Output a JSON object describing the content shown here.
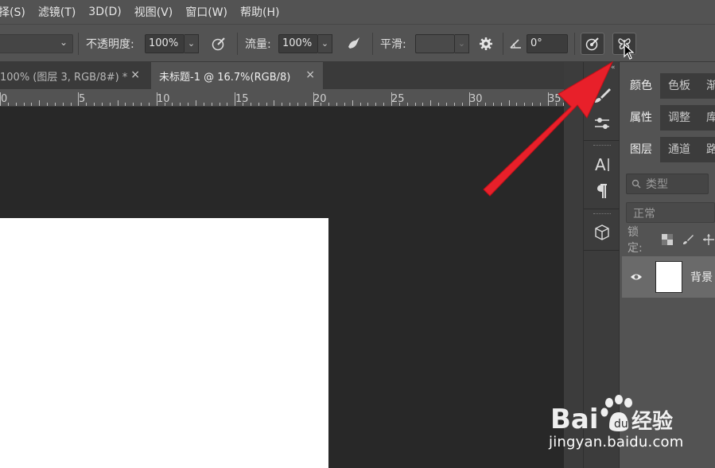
{
  "menu": [
    "择(S)",
    "滤镜(T)",
    "3D(D)",
    "视图(V)",
    "窗口(W)",
    "帮助(H)"
  ],
  "options": {
    "opacity_label": "不透明度:",
    "opacity_value": "100%",
    "flow_label": "流量:",
    "flow_value": "100%",
    "smooth_label": "平滑:",
    "smooth_value": "",
    "angle_value": "0°"
  },
  "tabs": [
    {
      "label": "100% (图层 3, RGB/8#) *",
      "close": "×"
    },
    {
      "label": "未标题-1 @ 16.7%(RGB/8)",
      "close": "×"
    }
  ],
  "ruler": {
    "ticks": [
      "0",
      "5",
      "10",
      "15",
      "20",
      "25",
      "30",
      "35"
    ]
  },
  "dock": {
    "collapse": "«"
  },
  "panels": {
    "group1": [
      "颜色",
      "色板",
      "渐"
    ],
    "group2": [
      "属性",
      "调整",
      "库"
    ],
    "group3": [
      "图层",
      "通道",
      "路"
    ],
    "filter_placeholder": "类型",
    "blend_mode": "正常",
    "lock_label": "锁定:",
    "layer_name": "背景"
  },
  "watermark": {
    "brand": "Bai du 经验",
    "url": "jingyan.baidu.com"
  },
  "colors": {
    "annotation_arrow": "#e8202a",
    "ui_dark": "#282828",
    "ui_panel": "#535353"
  }
}
